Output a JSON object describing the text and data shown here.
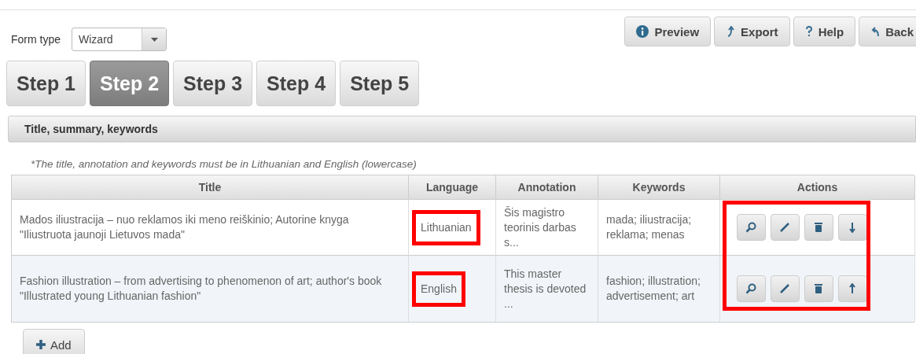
{
  "form_type": {
    "label": "Form type",
    "value": "Wizard"
  },
  "toolbar": [
    {
      "kind": "info",
      "label": "Preview"
    },
    {
      "kind": "export",
      "label": "Export"
    },
    {
      "kind": "help",
      "label": "Help"
    },
    {
      "kind": "back",
      "label": "Back"
    }
  ],
  "tabs": [
    {
      "label": "Step 1",
      "selected": false
    },
    {
      "label": "Step 2",
      "selected": true
    },
    {
      "label": "Step 3",
      "selected": false
    },
    {
      "label": "Step 4",
      "selected": false
    },
    {
      "label": "Step 5",
      "selected": false
    }
  ],
  "section": {
    "title": "Title, summary, keywords"
  },
  "note": "*The title, annotation and keywords must be in Lithuanian and English (lowercase)",
  "table": {
    "columns": [
      "Title",
      "Language",
      "Annotation",
      "Keywords",
      "Actions"
    ],
    "actions_highlighted": true,
    "rows": [
      {
        "title": "Mados iliustracija – nuo reklamos iki meno reiškinio; Autorine knyga \"Iliustruota jaunoji Lietuvos mada\"",
        "language": "Lithuanian",
        "language_highlighted": true,
        "annotation": "Šis magistro teorinis darbas s...",
        "keywords": "mada; iliustracija; reklama; menas",
        "actions": [
          {
            "kind": "view"
          },
          {
            "kind": "edit"
          },
          {
            "kind": "delete"
          },
          {
            "kind": "down"
          }
        ]
      },
      {
        "title": "Fashion illustration – from advertising to phenomenon of art; author's book \"Illustrated young Lithuanian fashion\"",
        "language": "English",
        "language_highlighted": true,
        "annotation": "This master thesis is devoted ...",
        "keywords": "fashion; illustration; advertisement; art",
        "actions": [
          {
            "kind": "view"
          },
          {
            "kind": "edit"
          },
          {
            "kind": "delete"
          },
          {
            "kind": "up"
          }
        ]
      }
    ]
  },
  "add_button": {
    "label": "Add"
  }
}
